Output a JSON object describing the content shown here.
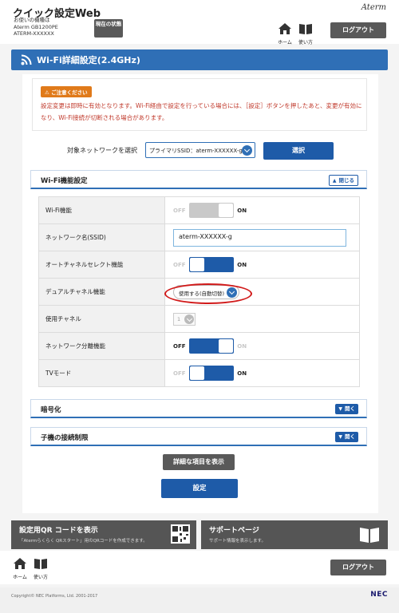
{
  "header": {
    "app_title": "クイック設定Web",
    "model_label": "お使いの機種は",
    "model_name": "Aterm GB1200PE",
    "device_name": "ATERM-XXXXXX",
    "status_button": "現在の状態",
    "brand": "Aterm",
    "home_label": "ホーム",
    "manual_label": "使い方",
    "logout_label": "ログアウト"
  },
  "page": {
    "title": "Wi-Fi詳細設定(2.4GHz)"
  },
  "notice": {
    "badge": "ご注意ください",
    "text": "設定変更は即時に有効となります。Wi-Fi経由で設定を行っている場合には、［設定］ボタンを押したあと、変更が有効になり、Wi-Fi接続が切断される場合があります。"
  },
  "network_select": {
    "label": "対象ネットワークを選択",
    "value": "プライマリSSID：aterm-XXXXXX-g",
    "button": "選択"
  },
  "wifi_section": {
    "title": "Wi-Fi機能設定",
    "toggle_label": "閉じる"
  },
  "settings": {
    "wifi": {
      "label": "Wi-Fi機能",
      "off": "OFF",
      "on": "ON"
    },
    "ssid": {
      "label": "ネットワーク名(SSID)",
      "value": "aterm-XXXXXX-g"
    },
    "auto_channel": {
      "label": "オートチャネルセレクト機能",
      "off": "OFF",
      "on": "ON"
    },
    "dual_channel": {
      "label": "デュアルチャネル機能",
      "value": "使用する(自動切替)"
    },
    "channel": {
      "label": "使用チャネル",
      "value": "1"
    },
    "separator": {
      "label": "ネットワーク分離機能",
      "off": "OFF",
      "on": "ON"
    },
    "tv_mode": {
      "label": "TVモード",
      "off": "OFF",
      "on": "ON"
    }
  },
  "encryption_section": {
    "title": "暗号化",
    "toggle_label": "開く"
  },
  "restriction_section": {
    "title": "子機の接続制限",
    "toggle_label": "開く"
  },
  "actions": {
    "details_button": "詳細な項目を表示",
    "save_button": "設定"
  },
  "panels": {
    "qr_title": "設定用QR コードを表示",
    "qr_desc": "「Atermらくらく QRスタート」用のQRコードを作成できます。",
    "support_title": "サポートページ",
    "support_desc": "サポート情報を表示します。"
  },
  "footer": {
    "home_label": "ホーム",
    "manual_label": "使い方",
    "logout_label": "ログアウト",
    "copyright": "Copyright© NEC Platforms, Ltd. 2001-2017",
    "nec": "NEC"
  },
  "colors": {
    "accent": "#2f6fb6",
    "button_dark": "#595959",
    "notice": "#c0392b",
    "highlight_ring": "#d11a1a"
  }
}
